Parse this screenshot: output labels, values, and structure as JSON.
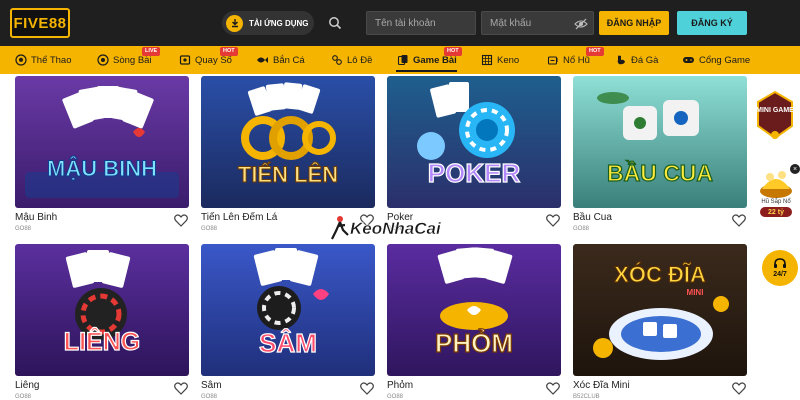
{
  "header": {
    "logo_text": "FIVE88",
    "download_label": "TẢI ỨNG DỤNG",
    "username_placeholder": "Tên tài khoản",
    "password_placeholder": "Mật khẩu",
    "login_label": "ĐĂNG NHẬP",
    "register_label": "ĐĂNG KÝ"
  },
  "nav": {
    "items": [
      {
        "label": "Thể Thao",
        "icon": "soccer-ball-icon"
      },
      {
        "label": "Sòng Bài",
        "icon": "casino-chip-icon",
        "badge": "LIVE"
      },
      {
        "label": "Quay Số",
        "icon": "lottery-icon",
        "badge": "HOT"
      },
      {
        "label": "Bắn Cá",
        "icon": "fish-icon"
      },
      {
        "label": "Lô Đề",
        "icon": "lotto-icon"
      },
      {
        "label": "Game Bài",
        "icon": "cards-icon",
        "badge": "HOT",
        "active": true
      },
      {
        "label": "Keno",
        "icon": "keno-grid-icon"
      },
      {
        "label": "Nổ Hũ",
        "icon": "slot-icon",
        "badge": "HOT"
      },
      {
        "label": "Đá Gà",
        "icon": "rooster-icon"
      },
      {
        "label": "Cổng Game",
        "icon": "gamepad-icon"
      }
    ]
  },
  "games": [
    {
      "art_title": "MẬU BINH",
      "name": "Mậu Binh",
      "provider": "GO88"
    },
    {
      "art_title": "TIẾN LÊN",
      "name": "Tiến Lên Đếm Lá",
      "provider": "GO88"
    },
    {
      "art_title": "POKER",
      "name": "Poker",
      "provider": "GO88"
    },
    {
      "art_title": "BẦU CUA",
      "name": "Bầu Cua",
      "provider": "GO88"
    },
    {
      "art_title": "LIÊNG",
      "name": "Liêng",
      "provider": "GO88"
    },
    {
      "art_title": "SÂM",
      "name": "Sâm",
      "provider": "GO88"
    },
    {
      "art_title": "PHỎM",
      "name": "Phỏm",
      "provider": "GO88"
    },
    {
      "art_title": "XÓC ĐĨA",
      "art_subtitle": "MINI",
      "name": "Xóc Đĩa Mini",
      "provider": "B52CLUB"
    }
  ],
  "watermark": {
    "text": "KeoNhaCai"
  },
  "floating": {
    "mini_game_label": "MINI GAME",
    "jackpot_label": "Hũ Sắp Nổ",
    "jackpot_value": "22 tỷ",
    "close_label": "×",
    "support_label": "24/7"
  },
  "colors": {
    "header_bg": "#1f1f1f",
    "nav_bg": "#f5b400",
    "login_bg": "#f5b400",
    "register_bg": "#4fd1d9"
  }
}
